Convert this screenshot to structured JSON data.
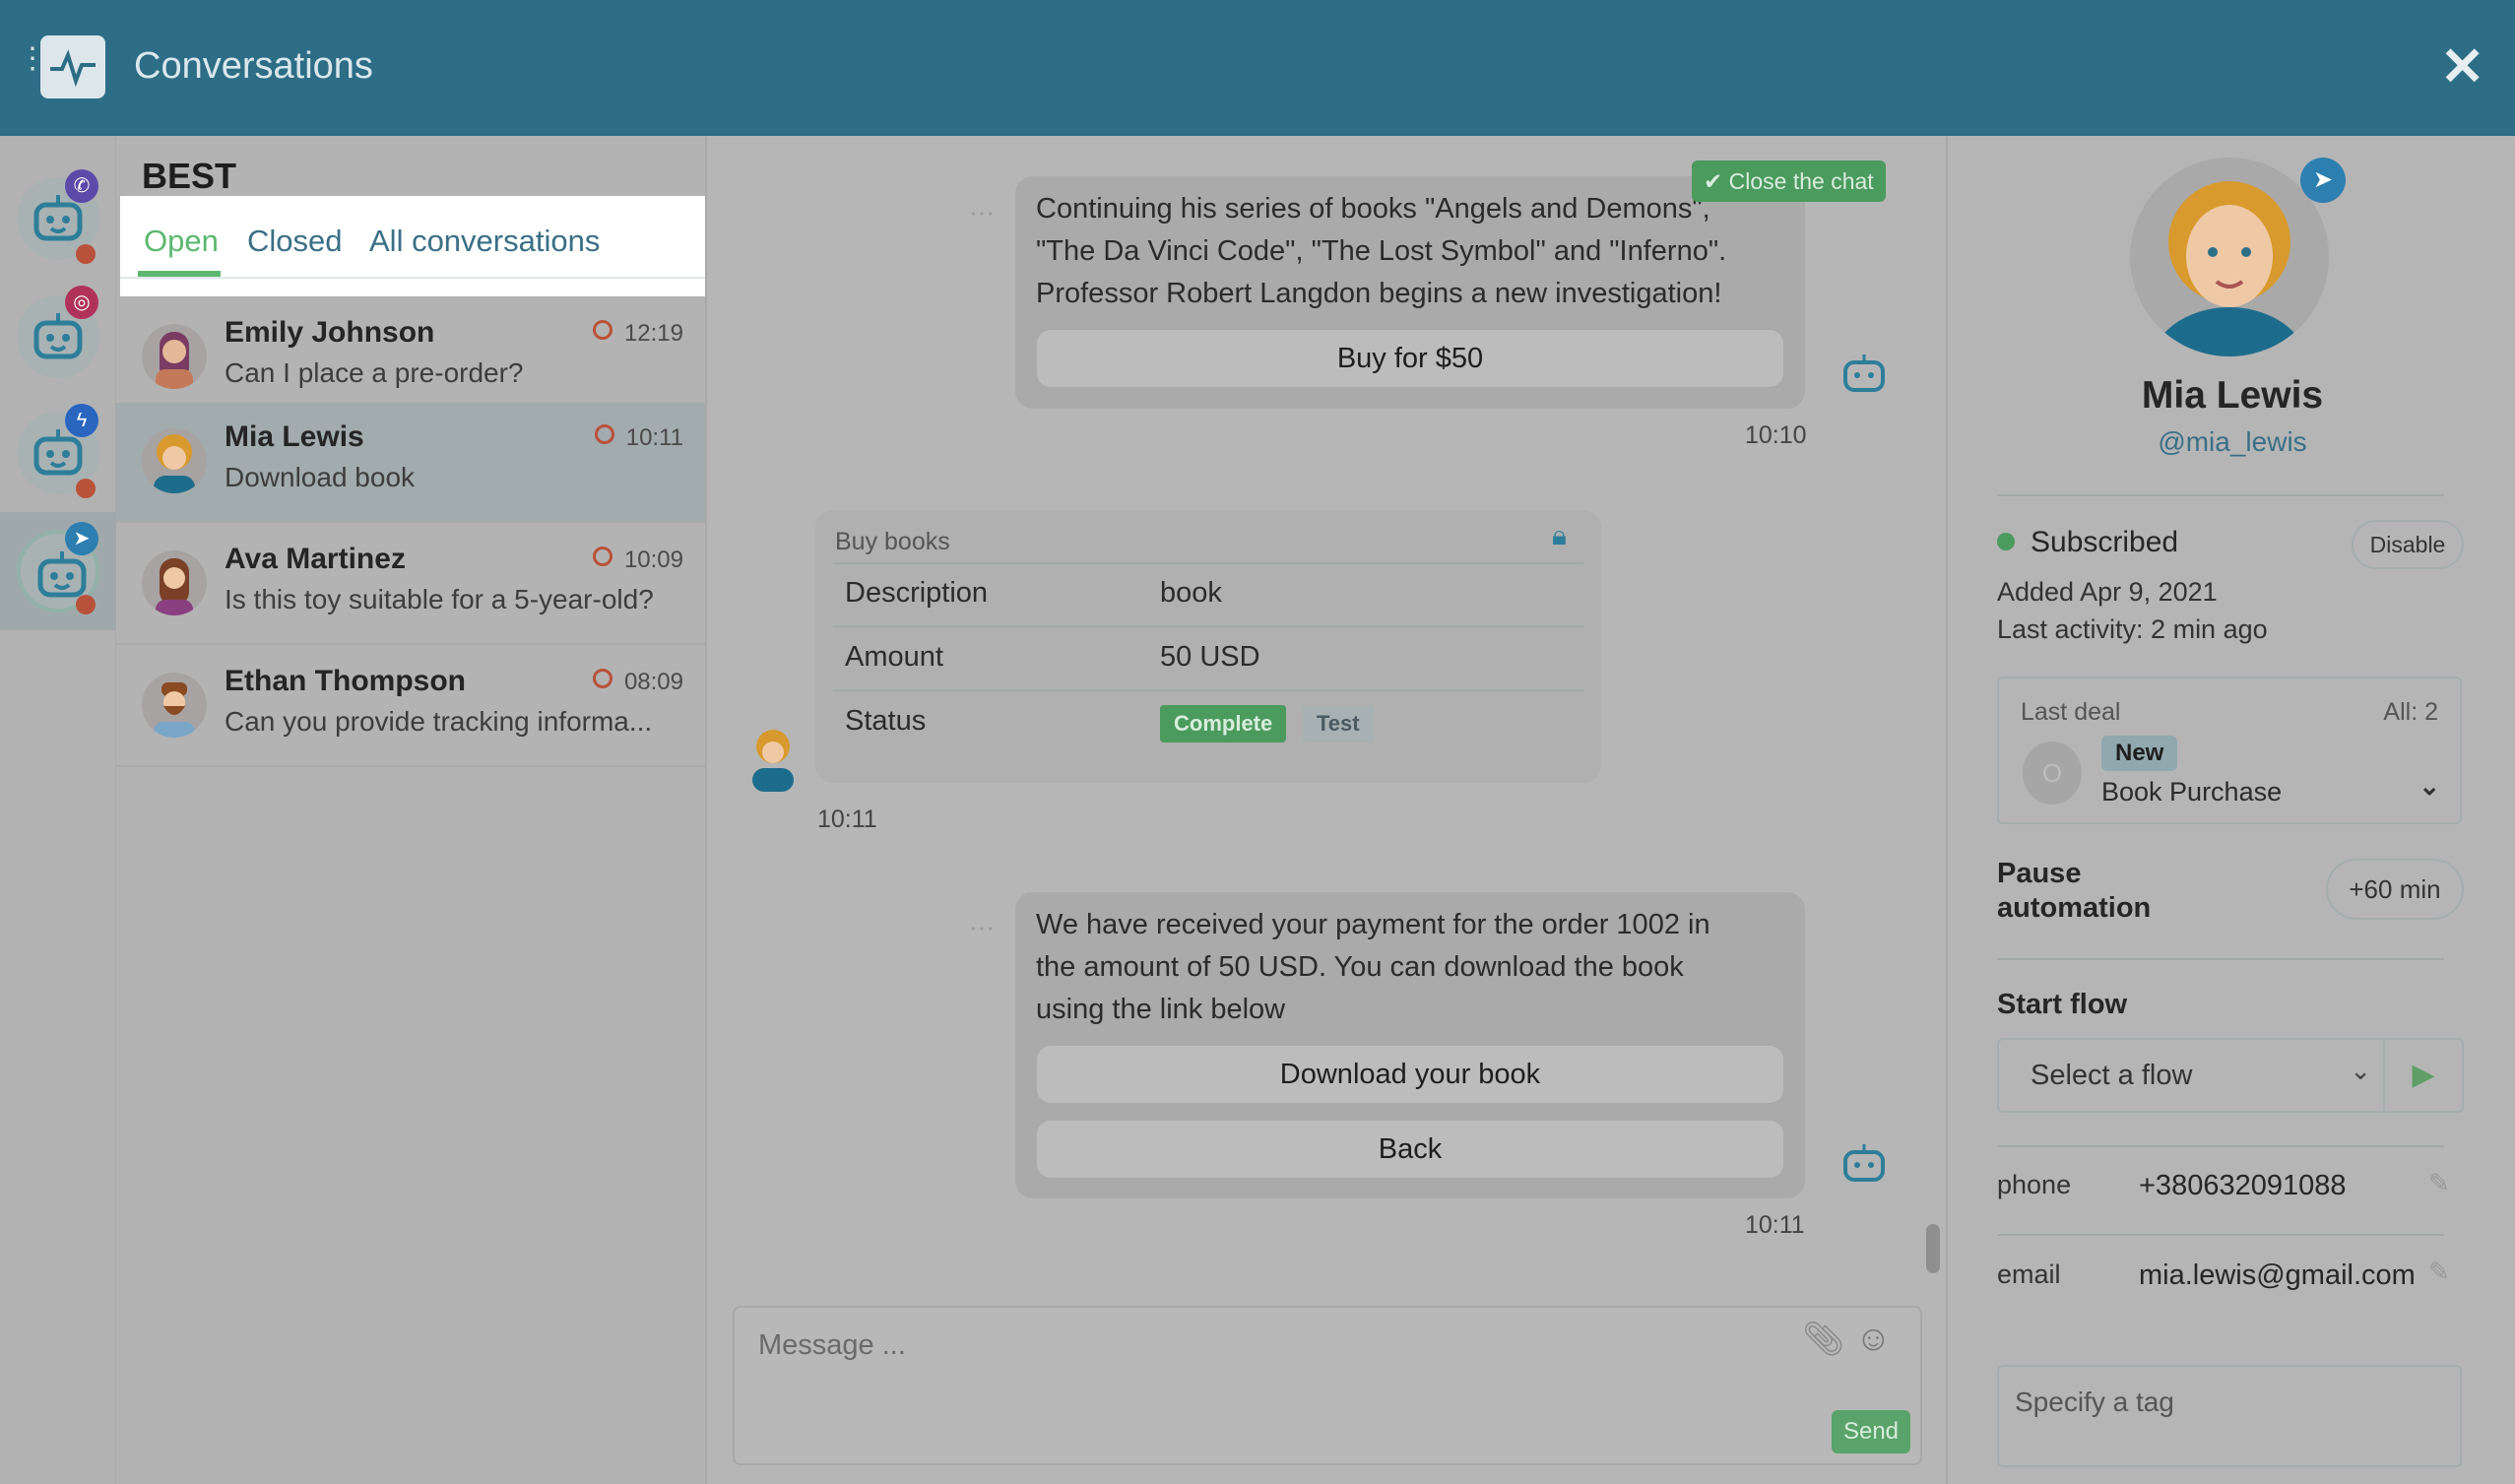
{
  "header": {
    "title": "Conversations",
    "logo_icon": "pulse-icon",
    "close_icon": "close-icon",
    "menu_icon": "kebab-icon"
  },
  "colors": {
    "header": "#2d6d86",
    "accent": "#4caf6a",
    "open_tab": "#5cb86f",
    "unread": "#b8523a"
  },
  "channels": [
    {
      "icon": "viber-icon",
      "color": "#5b4aa8"
    },
    {
      "icon": "instagram-icon",
      "color": "#b0325a"
    },
    {
      "icon": "messenger-icon",
      "color": "#2a66c0"
    },
    {
      "icon": "telegram-icon",
      "color": "#2d7fb0"
    }
  ],
  "list": {
    "title": "BEST",
    "tabs": [
      {
        "label": "Open"
      },
      {
        "label": "Closed"
      },
      {
        "label": "All conversations"
      }
    ],
    "conversations": [
      {
        "name": "Emily Johnson",
        "preview": "Can I place a pre-order?",
        "time": "12:19"
      },
      {
        "name": "Mia Lewis",
        "preview": "Download book",
        "time": "10:11"
      },
      {
        "name": "Ava Martinez",
        "preview": "Is this toy suitable for a 5-year-old?",
        "time": "10:09"
      },
      {
        "name": "Ethan Thompson",
        "preview": "Can you provide tracking informa...",
        "time": "08:09"
      }
    ]
  },
  "chat": {
    "close_label": "Close the chat",
    "msg1": {
      "lines": [
        "Continuing his series of books \"Angels and Demons\",",
        "\"The Da Vinci Code\", \"The Lost Symbol\" and \"Inferno\".",
        "Professor Robert Langdon begins a new investigation!"
      ],
      "button": "Buy for $50",
      "time": "10:10"
    },
    "card": {
      "title": "Buy books",
      "rows": [
        {
          "k": "Description",
          "v": "book"
        },
        {
          "k": "Amount",
          "v": "50 USD"
        },
        {
          "k": "Status",
          "v": ""
        }
      ],
      "status_badge": "Complete",
      "test_badge": "Test",
      "time": "10:11"
    },
    "msg2": {
      "lines": [
        "We have received your payment for the order 1002 in",
        "the amount of 50 USD. You can download the book",
        "using the link below"
      ],
      "buttons": [
        "Download your book",
        "Back"
      ],
      "time": "10:11"
    },
    "input": {
      "placeholder": "Message ...",
      "send": "Send"
    }
  },
  "profile": {
    "name": "Mia Lewis",
    "handle": "@mia_lewis",
    "status": "Subscribed",
    "disable": "Disable",
    "added": "Added Apr 9, 2021",
    "last_activity": "Last activity: 2 min ago",
    "deal": {
      "label": "Last deal",
      "all": "All: 2",
      "avatar_letter": "O",
      "stage": "New",
      "name": "Book Purchase"
    },
    "pause": {
      "label1": "Pause",
      "label2": "automation",
      "button": "+60 min"
    },
    "flow": {
      "label": "Start flow",
      "placeholder": "Select a flow"
    },
    "fields": [
      {
        "k": "phone",
        "v": "+380632091088"
      },
      {
        "k": "email",
        "v": "mia.lewis@gmail.com"
      }
    ],
    "tag_placeholder": "Specify a tag"
  }
}
